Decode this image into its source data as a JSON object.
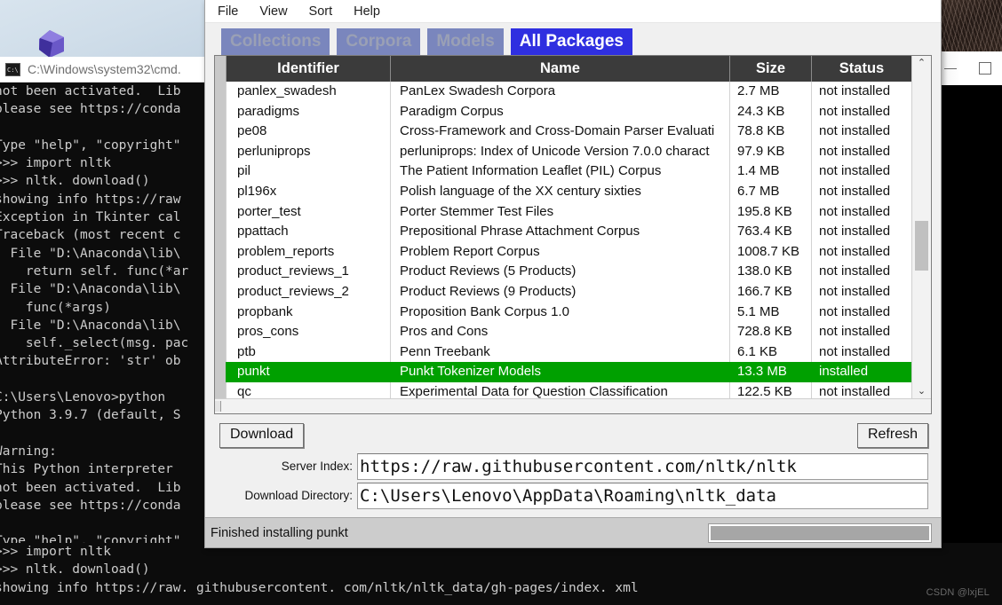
{
  "desktop": {
    "wallpaper_icon": "windows-hero-shape"
  },
  "window_controls": {
    "minimize": "minimize-icon",
    "maximize": "maximize-icon"
  },
  "cmd": {
    "title": "C:\\Windows\\system32\\cmd.",
    "icon": "cmd-icon",
    "lines": [
      "not been activated.  Lib",
      "please see https://conda",
      "",
      "Type \"help\", \"copyright\"",
      ">>> import nltk",
      ">>> nltk. download()",
      "showing info https://raw",
      "Exception in Tkinter cal",
      "Traceback (most recent c",
      "  File \"D:\\Anaconda\\lib\\",
      "    return self. func(*ar",
      "  File \"D:\\Anaconda\\lib\\",
      "    func(*args)",
      "  File \"D:\\Anaconda\\lib\\",
      "    self._select(msg. pac",
      "AttributeError: 'str' ob",
      "",
      "C:\\Users\\Lenovo>python",
      "Python 3.9.7 (default, S",
      "",
      "Warning:",
      "This Python interpreter",
      "not been activated.  Lib",
      "please see https://conda",
      "",
      "Type \"help\", \"copyright\""
    ]
  },
  "console_bottom": {
    "lines": [
      ">>> import nltk",
      ">>> nltk. download()",
      "showing info https://raw. githubusercontent. com/nltk/nltk_data/gh-pages/index. xml"
    ]
  },
  "watermark": "CSDN @lxjEL",
  "nltk": {
    "menu": [
      "File",
      "View",
      "Sort",
      "Help"
    ],
    "tabs": [
      {
        "label": "Collections",
        "active": false
      },
      {
        "label": "Corpora",
        "active": false
      },
      {
        "label": "Models",
        "active": false
      },
      {
        "label": "All Packages",
        "active": true
      }
    ],
    "table": {
      "columns": [
        "Identifier",
        "Name",
        "Size",
        "Status"
      ],
      "rows": [
        {
          "id": "panlex_swadesh",
          "name": "PanLex Swadesh Corpora",
          "size": "2.7 MB",
          "status": "not installed",
          "selected": false
        },
        {
          "id": "paradigms",
          "name": "Paradigm Corpus",
          "size": "24.3 KB",
          "status": "not installed",
          "selected": false
        },
        {
          "id": "pe08",
          "name": "Cross-Framework and Cross-Domain Parser Evaluati",
          "size": "78.8 KB",
          "status": "not installed",
          "selected": false
        },
        {
          "id": "perluniprops",
          "name": "perluniprops: Index of Unicode Version 7.0.0 charact",
          "size": "97.9 KB",
          "status": "not installed",
          "selected": false
        },
        {
          "id": "pil",
          "name": "The Patient Information Leaflet (PIL) Corpus",
          "size": "1.4 MB",
          "status": "not installed",
          "selected": false
        },
        {
          "id": "pl196x",
          "name": "Polish language of the XX century sixties",
          "size": "6.7 MB",
          "status": "not installed",
          "selected": false
        },
        {
          "id": "porter_test",
          "name": "Porter Stemmer Test Files",
          "size": "195.8 KB",
          "status": "not installed",
          "selected": false
        },
        {
          "id": "ppattach",
          "name": "Prepositional Phrase Attachment Corpus",
          "size": "763.4 KB",
          "status": "not installed",
          "selected": false
        },
        {
          "id": "problem_reports",
          "name": "Problem Report Corpus",
          "size": "1008.7 KB",
          "status": "not installed",
          "selected": false
        },
        {
          "id": "product_reviews_1",
          "name": "Product Reviews (5 Products)",
          "size": "138.0 KB",
          "status": "not installed",
          "selected": false
        },
        {
          "id": "product_reviews_2",
          "name": "Product Reviews (9 Products)",
          "size": "166.7 KB",
          "status": "not installed",
          "selected": false
        },
        {
          "id": "propbank",
          "name": "Proposition Bank Corpus 1.0",
          "size": "5.1 MB",
          "status": "not installed",
          "selected": false
        },
        {
          "id": "pros_cons",
          "name": "Pros and Cons",
          "size": "728.8 KB",
          "status": "not installed",
          "selected": false
        },
        {
          "id": "ptb",
          "name": "Penn Treebank",
          "size": "6.1 KB",
          "status": "not installed",
          "selected": false
        },
        {
          "id": "punkt",
          "name": "Punkt Tokenizer Models",
          "size": "13.3 MB",
          "status": "installed",
          "selected": true
        },
        {
          "id": "qc",
          "name": "Experimental Data for Question Classification",
          "size": "122.5 KB",
          "status": "not installed",
          "selected": false
        }
      ]
    },
    "scrollbar": {
      "up": "⌃",
      "down": "⌄"
    },
    "buttons": {
      "download": "Download",
      "refresh": "Refresh"
    },
    "fields": [
      {
        "label": "Server Index:",
        "value": "https://raw.githubusercontent.com/nltk/nltk"
      },
      {
        "label": "Download Directory:",
        "value": "C:\\Users\\Lenovo\\AppData\\Roaming\\nltk_data"
      }
    ],
    "status": {
      "message": "Finished installing punkt",
      "progress_percent": 0
    }
  },
  "colors": {
    "tab_active_bg": "#2f2fe0",
    "tab_inactive_bg": "#7a86bd",
    "selected_row_bg": "#00a000",
    "header_bg": "#3b3b3b",
    "console_bg": "#0c0c0c"
  }
}
